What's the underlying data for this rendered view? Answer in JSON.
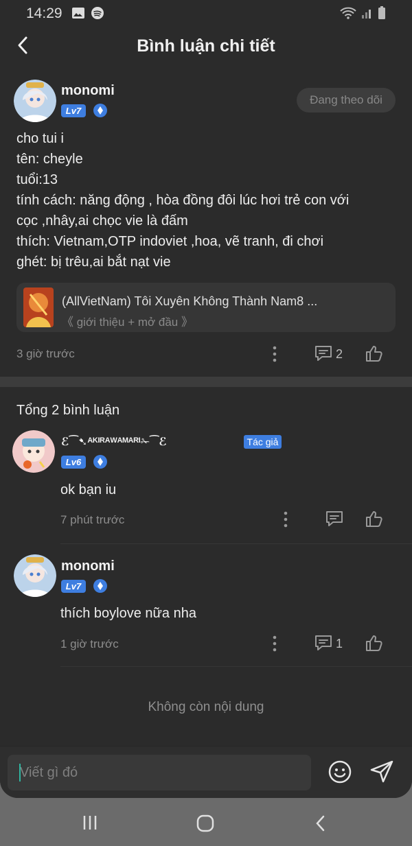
{
  "status_bar": {
    "time": "14:29"
  },
  "header": {
    "title": "Bình luận chi tiết"
  },
  "post": {
    "username": "monomi",
    "level": "Lv7",
    "follow_label": "Đang theo dõi",
    "lines": [
      "cho tui i",
      "tên: cheyle",
      "tuổi:13",
      "tính cách: năng động , hòa đồng đôi lúc hơi trẻ con với",
      "cọc ,nhây,ai chọc vie là đấm",
      "thích: Vietnam,OTP indoviet ,hoa, vẽ tranh, đi chơi",
      "ghét: bị trêu,ai bắt nạt vie"
    ],
    "book": {
      "title": "(AllVietNam) Tôi Xuyên Không Thành Nam8 ...",
      "subtitle": "《 giới thiệu + mở đầu 》"
    },
    "time": "3 giờ trước",
    "comment_count": "2"
  },
  "comments_section": {
    "total_label": "Tổng 2 bình luận",
    "items": [
      {
        "username": "ℰ⁀➷ᴬᴷᴵᴿᴬᵂᴬᴹᴬᴿᴵ✁⁀ℰ",
        "level": "Lv6",
        "author_badge": "Tác giả",
        "text": "ok bạn iu",
        "time": "7 phút trước",
        "reply_count": ""
      },
      {
        "username": "monomi",
        "level": "Lv7",
        "text": "thích boylove nữa nha",
        "time": "1 giờ trước",
        "reply_count": "1"
      }
    ],
    "end_label": "Không còn nội dung"
  },
  "composer": {
    "placeholder": "Viết gì đó"
  },
  "colors": {
    "background": "#2b2b2b",
    "accent": "#3e7ee0",
    "nav": "#6b6b6b"
  }
}
